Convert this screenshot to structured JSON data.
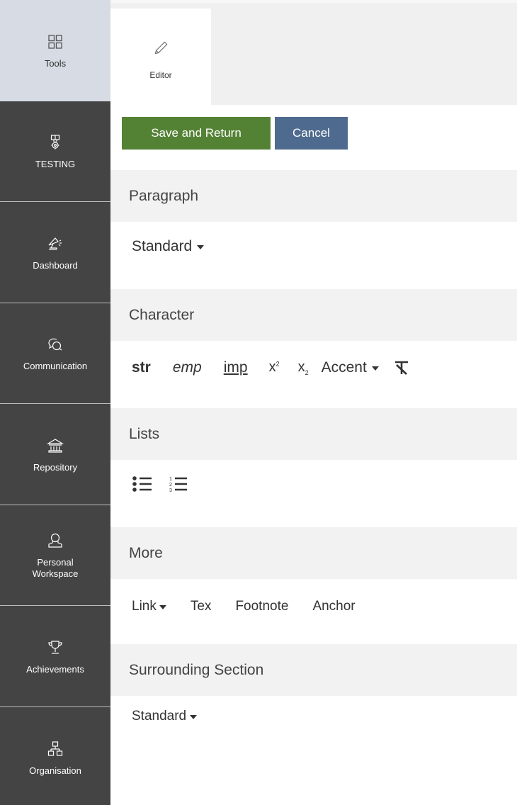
{
  "sidebar": {
    "items": [
      {
        "label": "Tools",
        "icon": "grid-icon"
      },
      {
        "label": "TESTING",
        "icon": "badge-icon"
      },
      {
        "label": "Dashboard",
        "icon": "lamp-icon"
      },
      {
        "label": "Communication",
        "icon": "chat-icon"
      },
      {
        "label": "Repository",
        "icon": "bank-icon"
      },
      {
        "label": "Personal\nWorkspace",
        "icon": "person-icon"
      },
      {
        "label": "Achievements",
        "icon": "trophy-icon"
      },
      {
        "label": "Organisation",
        "icon": "org-chart-icon"
      }
    ]
  },
  "tabs": {
    "editor_label": "Editor"
  },
  "actions": {
    "save_label": "Save and Return",
    "cancel_label": "Cancel"
  },
  "sections": {
    "paragraph": {
      "title": "Paragraph",
      "dropdown": "Standard"
    },
    "character": {
      "title": "Character",
      "str": "str",
      "emp": "emp",
      "imp": "imp",
      "sup_base": "x",
      "sup_mark": "2",
      "sub_base": "x",
      "sub_mark": "2",
      "accent": "Accent"
    },
    "lists": {
      "title": "Lists"
    },
    "more": {
      "title": "More",
      "link": "Link",
      "tex": "Tex",
      "footnote": "Footnote",
      "anchor": "Anchor"
    },
    "surrounding": {
      "title": "Surrounding Section",
      "dropdown": "Standard"
    }
  },
  "colors": {
    "save_button": "#548235",
    "cancel_button": "#4e6a8e",
    "sidebar_bg": "#444444",
    "sidebar_active": "#d6dbe4"
  }
}
